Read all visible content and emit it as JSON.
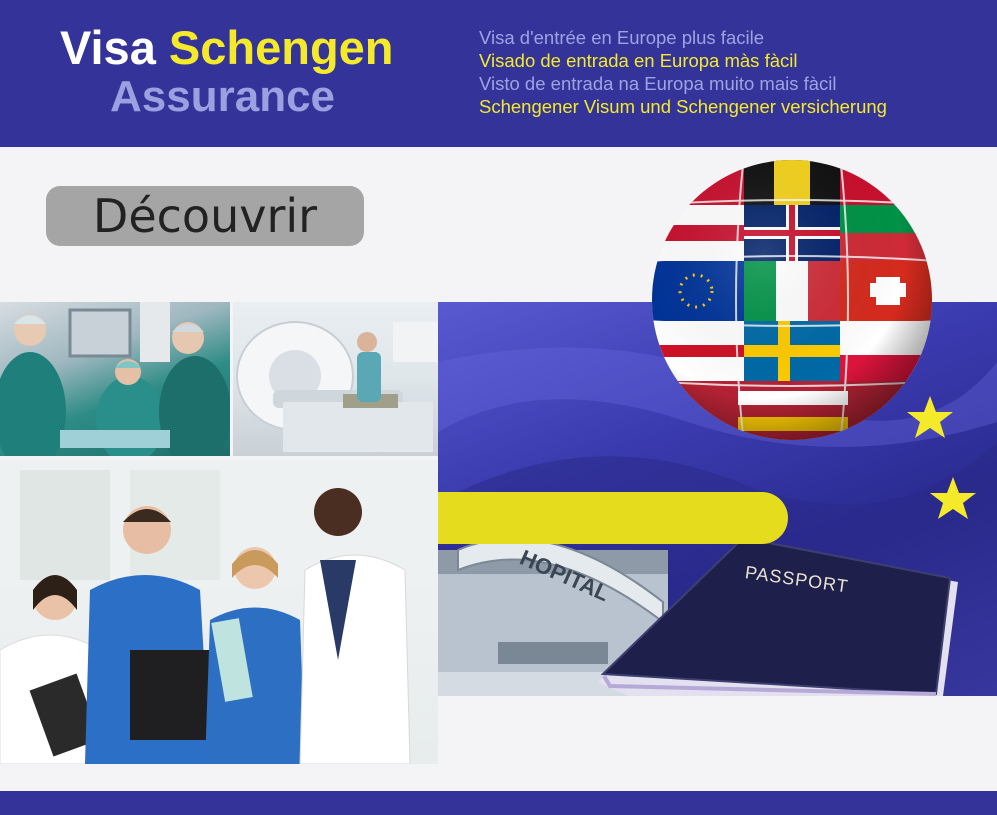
{
  "header": {
    "logo": {
      "visa": "Visa",
      "schengen": "Schengen",
      "assurance": "Assurance"
    },
    "taglines": [
      "Visa d'entrée en Europe plus facile",
      "Visado de entrada en Europa màs fàcil",
      "Visto de entrada na Europa muito mais fàcil",
      "Schengener Visum und Schengener versicherung"
    ]
  },
  "cta": {
    "label": "Découvrir"
  },
  "images": {
    "hospital_sign": "HOPITAL",
    "passport_title": "PASSPORT"
  },
  "colors": {
    "brand_blue": "#33339a",
    "accent_yellow": "#f4ea2a",
    "tagline_light": "#9ea3e2",
    "button_grey": "#a5a5a5"
  }
}
